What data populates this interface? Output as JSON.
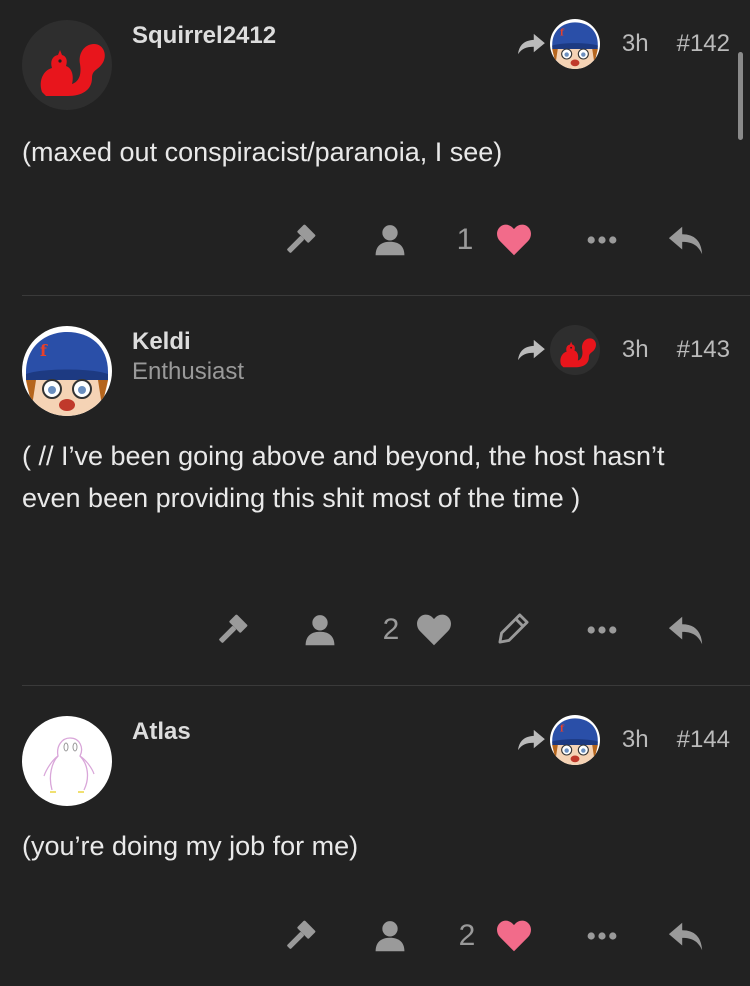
{
  "posts": [
    {
      "username": "Squirrel2412",
      "user_title": "",
      "time": "3h",
      "post_number": "#142",
      "body": "(maxed out conspiracist/paranoia, I see)",
      "like_count": "1",
      "liked": true
    },
    {
      "username": "Keldi",
      "user_title": "Enthusiast",
      "time": "3h",
      "post_number": "#143",
      "body": "( // I’ve been going above and beyond, the host hasn’t even been providing this shit most of the time )",
      "like_count": "2",
      "liked": false
    },
    {
      "username": "Atlas",
      "user_title": "",
      "time": "3h",
      "post_number": "#144",
      "body": "(you’re doing my job for me)",
      "like_count": "2",
      "liked": true
    }
  ],
  "colors": {
    "background": "#222222",
    "heart_liked": "#f26b8a",
    "icon_gray": "#9a9a9a",
    "squirrel_red": "#e8151c",
    "cap_blue": "#2a4fa8"
  },
  "icons": {
    "moderate": "gavel-icon",
    "admin": "user-icon",
    "like": "heart-icon",
    "edit": "pencil-icon",
    "more": "ellipsis-icon",
    "reply": "reply-icon",
    "reply_to": "share-arrow-icon"
  }
}
